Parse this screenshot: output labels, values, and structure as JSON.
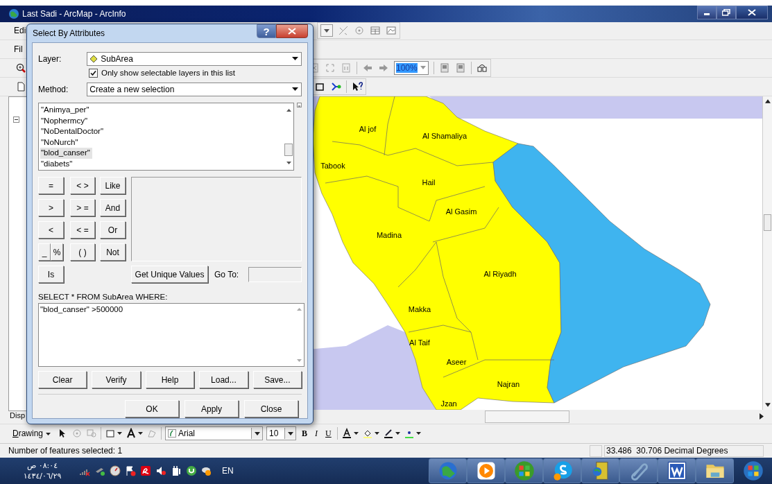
{
  "window": {
    "title": "Last Sadi - ArcMap - ArcInfo"
  },
  "editor_toolbar": {
    "label": "Edi"
  },
  "menu_bar": {
    "label": "Fil"
  },
  "layout_toolbar": {
    "zoom": "100%"
  },
  "toc": {
    "tab": "Disp"
  },
  "map": {
    "regions": [
      {
        "name": "Al jof"
      },
      {
        "name": "Al Shamaliya"
      },
      {
        "name": "Tabook"
      },
      {
        "name": "Hail"
      },
      {
        "name": "Al Gasim"
      },
      {
        "name": "Madina"
      },
      {
        "name": "Al Riyadh"
      },
      {
        "name": "Makka"
      },
      {
        "name": "Al Taif"
      },
      {
        "name": "Aseer"
      },
      {
        "name": "Najran"
      },
      {
        "name": "Jzan"
      }
    ]
  },
  "drawing_toolbar": {
    "menu": "Drawing",
    "font": "Arial",
    "size": "10",
    "bold": "B",
    "italic": "I",
    "underline": "U"
  },
  "status_bar": {
    "message": "Number of features selected: 1",
    "coordinates": "33.486  30.706 Decimal Degrees"
  },
  "taskbar": {
    "time": "٠٨:٠٤ ص",
    "date": "١٤٣٤/٠٦/٢٩",
    "language": "EN"
  },
  "dialog": {
    "title": "Select By Attributes",
    "help": "?",
    "layer_label": "Layer:",
    "layer": "SubArea",
    "checkbox": {
      "label": "Only show selectable layers in this list",
      "checked": true
    },
    "method_label": "Method:",
    "method": "Create a new selection",
    "fields": [
      {
        "label": "\"Animya_per\"",
        "selected": false
      },
      {
        "label": "\"Nophermcy\"",
        "selected": false
      },
      {
        "label": "\"NoDentalDoctor\"",
        "selected": false
      },
      {
        "label": "\"NoNurch\"",
        "selected": false
      },
      {
        "label": "\"blod_canser\"",
        "selected": true
      },
      {
        "label": "\"diabets\"",
        "selected": false
      }
    ],
    "operator_rows": [
      [
        [
          "="
        ],
        [
          "< >"
        ],
        [
          "Like"
        ]
      ],
      [
        [
          ">"
        ],
        [
          "> ="
        ],
        [
          "And"
        ]
      ],
      [
        [
          "<"
        ],
        [
          "< ="
        ],
        [
          "Or"
        ]
      ],
      [
        [
          "_",
          "%"
        ],
        [
          "( )"
        ],
        [
          "Not"
        ]
      ],
      [
        [
          "Is"
        ]
      ]
    ],
    "unique_values": "Get Unique Values",
    "goto_label": "Go To:",
    "query_label": "SELECT * FROM SubArea WHERE:",
    "query": "\"blod_canser\" >500000",
    "buttons": [
      "Clear",
      "Verify",
      "Help",
      "Load...",
      "Save..."
    ],
    "footer_buttons": [
      "OK",
      "Apply",
      "Close"
    ]
  }
}
